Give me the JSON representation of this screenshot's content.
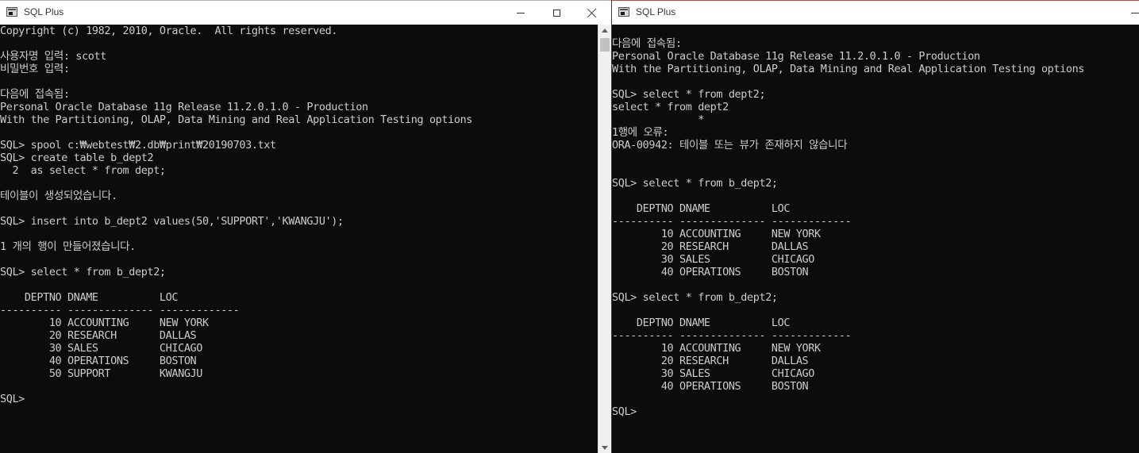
{
  "left_window": {
    "title": "SQL Plus",
    "lines": [
      "Copyright (c) 1982, 2010, Oracle.  All rights reserved.",
      "",
      "사용자명 입력: scott",
      "비밀번호 입력:",
      "",
      "다음에 접속됨:",
      "Personal Oracle Database 11g Release 11.2.0.1.0 - Production",
      "With the Partitioning, OLAP, Data Mining and Real Application Testing options",
      "",
      "SQL> spool c:₩webtest₩2.db₩print₩20190703.txt",
      "SQL> create table b_dept2",
      "  2  as select * from dept;",
      "",
      "테이블이 생성되었습니다.",
      "",
      "SQL> insert into b_dept2 values(50,'SUPPORT','KWANGJU');",
      "",
      "1 개의 행이 만들어졌습니다.",
      "",
      "SQL> select * from b_dept2;",
      "",
      "    DEPTNO DNAME          LOC",
      "---------- -------------- -------------",
      "        10 ACCOUNTING     NEW YORK",
      "        20 RESEARCH       DALLAS",
      "        30 SALES          CHICAGO",
      "        40 OPERATIONS     BOSTON",
      "        50 SUPPORT        KWANGJU",
      "",
      "SQL>"
    ]
  },
  "right_window": {
    "title": "SQL Plus",
    "lines": [
      "",
      "다음에 접속됨:",
      "Personal Oracle Database 11g Release 11.2.0.1.0 - Production",
      "With the Partitioning, OLAP, Data Mining and Real Application Testing options",
      "",
      "SQL> select * from dept2;",
      "select * from dept2",
      "              *",
      "1행에 오류:",
      "ORA-00942: 테이블 또는 뷰가 존재하지 않습니다",
      "",
      "",
      "SQL> select * from b_dept2;",
      "",
      "    DEPTNO DNAME          LOC",
      "---------- -------------- -------------",
      "        10 ACCOUNTING     NEW YORK",
      "        20 RESEARCH       DALLAS",
      "        30 SALES          CHICAGO",
      "        40 OPERATIONS     BOSTON",
      "",
      "SQL> select * from b_dept2;",
      "",
      "    DEPTNO DNAME          LOC",
      "---------- -------------- -------------",
      "        10 ACCOUNTING     NEW YORK",
      "        20 RESEARCH       DALLAS",
      "        30 SALES          CHICAGO",
      "        40 OPERATIONS     BOSTON",
      "",
      "SQL>"
    ]
  }
}
